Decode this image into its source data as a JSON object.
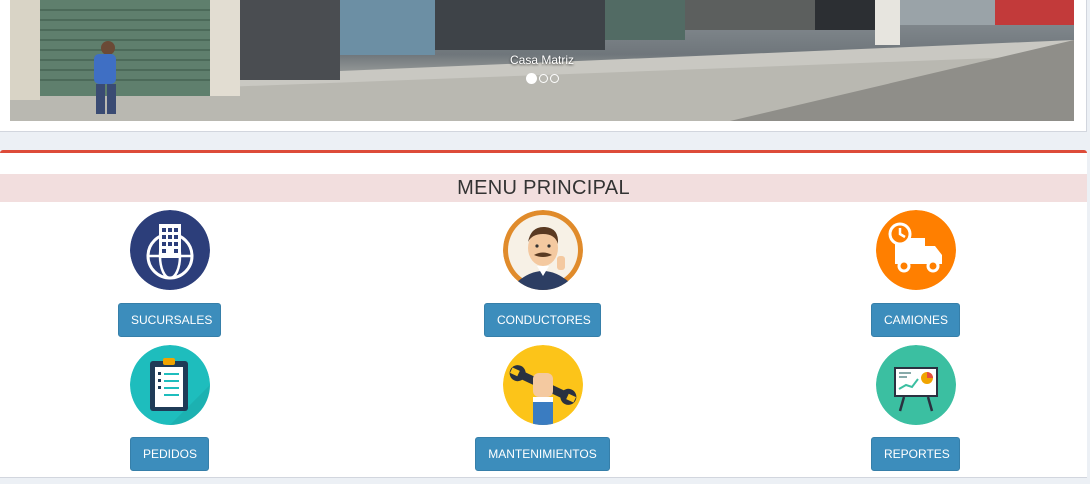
{
  "carousel": {
    "caption": "Casa Matriz",
    "indicators": [
      true,
      false,
      false
    ]
  },
  "menu": {
    "title": "MENU PRINCIPAL",
    "items": [
      {
        "label": "SUCURSALES",
        "icon": "building-globe-icon",
        "color": "#2c3e7a"
      },
      {
        "label": "CONDUCTORES",
        "icon": "driver-icon",
        "color": "#e08b2b"
      },
      {
        "label": "CAMIONES",
        "icon": "truck-clock-icon",
        "color": "#ff7f00"
      },
      {
        "label": "PEDIDOS",
        "icon": "clipboard-icon",
        "color": "#1ebdbd"
      },
      {
        "label": "MANTENIMIENTOS",
        "icon": "wrench-hand-icon",
        "color": "#fcc419"
      },
      {
        "label": "REPORTES",
        "icon": "presentation-board-icon",
        "color": "#3bbfa1"
      }
    ]
  },
  "colors": {
    "button": "#3c8dbc",
    "box_accent": "#dd4b39",
    "title_bg": "#f2dede"
  }
}
